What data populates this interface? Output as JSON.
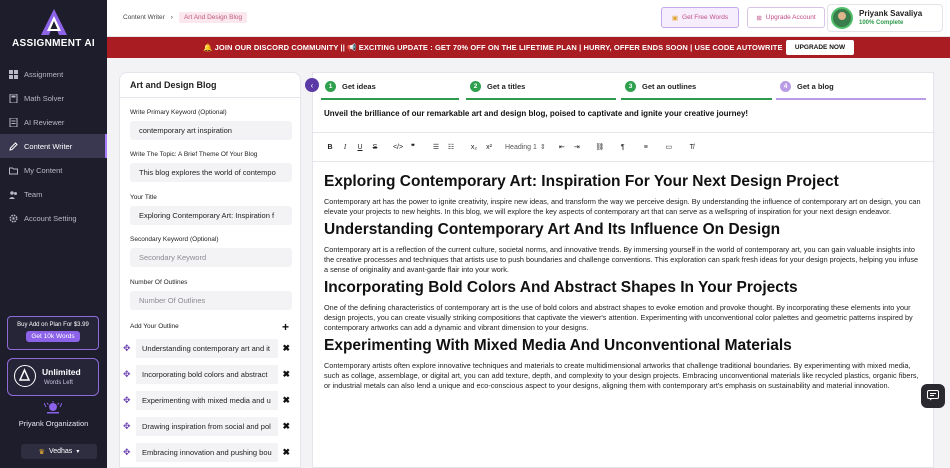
{
  "sidebar": {
    "logo_text": "ASSIGNMENT AI",
    "items": [
      {
        "label": "Assignment",
        "icon": "grid-icon"
      },
      {
        "label": "Math Solver",
        "icon": "calculator-icon"
      },
      {
        "label": "AI Reviewer",
        "icon": "document-icon"
      },
      {
        "label": "Content Writer",
        "icon": "pencil-icon",
        "active": true
      },
      {
        "label": "My Content",
        "icon": "folder-icon"
      },
      {
        "label": "Team",
        "icon": "people-icon"
      },
      {
        "label": "Account Setting",
        "icon": "gear-icon"
      }
    ],
    "addon_title": "Buy Add on Plan For $3.99",
    "addon_button": "Get 10k Words",
    "plan_title": "Unlimited",
    "plan_sub": "Words Left",
    "org_name": "Priyank Organization",
    "workspace": "Vedhas"
  },
  "topbar": {
    "breadcrumb_root": "Content Writer",
    "breadcrumb_current": "Art And Design Blog",
    "free_words": "Get Free Words",
    "upgrade": "Upgrade Account",
    "user_name": "Priyank Savaliya",
    "user_status": "100% Complete"
  },
  "banner": {
    "text": "🔔 JOIN OUR DISCORD COMMUNITY || 📢 EXCITING UPDATE : GET 70% OFF ON THE LIFETIME PLAN | HURRY, OFFER ENDS SOON | USE CODE AUTOWRITE",
    "button": "UPGRADE NOW"
  },
  "form": {
    "title": "Art and Design Blog",
    "primary_keyword_label": "Write Primary Keyword (Optional)",
    "primary_keyword_value": "contemporary art inspiration",
    "topic_label": "Write The Topic: A Brief Theme Of Your Blog",
    "topic_value": "This blog explores the world of contempo",
    "title_label": "Your Title",
    "title_value": "Exploring Contemporary Art: Inspiration f",
    "secondary_label": "Secondary Keyword (Optional)",
    "secondary_placeholder": "Secondary Keyword",
    "outlines_label": "Number Of Outlines",
    "outlines_placeholder": "Number Of Outlines",
    "add_outline_label": "Add Your Outline",
    "outline_items": [
      "Understanding contemporary art and it",
      "Incorporating bold colors and abstract",
      "Experimenting with mixed media and u",
      "Drawing inspiration from social and pol",
      "Embracing innovation and pushing bou"
    ]
  },
  "steps": [
    {
      "num": "1",
      "label": "Get ideas"
    },
    {
      "num": "2",
      "label": "Get a titles"
    },
    {
      "num": "3",
      "label": "Get an outlines"
    },
    {
      "num": "4",
      "label": "Get a blog"
    }
  ],
  "editor": {
    "intro": "Unveil the brilliance of our remarkable art and design blog, poised to captivate and ignite your creative journey!",
    "heading_select": "Heading 1",
    "h1": "Exploring Contemporary Art: Inspiration For Your Next Design Project",
    "p1": "Contemporary art has the power to ignite creativity, inspire new ideas, and transform the way we perceive design. By understanding the influence of contemporary art on design, you can elevate your projects to new heights. In this blog, we will explore the key aspects of contemporary art that can serve as a wellspring of inspiration for your next design endeavor.",
    "h2a": "Understanding Contemporary Art And Its Influence On Design",
    "p2": "Contemporary art is a reflection of the current culture, societal norms, and innovative trends. By immersing yourself in the world of contemporary art, you can gain valuable insights into the creative processes and techniques that artists use to push boundaries and challenge conventions. This exploration can spark fresh ideas for your design projects, helping you infuse a sense of originality and avant-garde flair into your work.",
    "h2b": "Incorporating Bold Colors And Abstract Shapes In Your Projects",
    "p3": "One of the defining characteristics of contemporary art is the use of bold colors and abstract shapes to evoke emotion and provoke thought. By incorporating these elements into your design projects, you can create visually striking compositions that captivate the viewer's attention. Experimenting with unconventional color palettes and geometric patterns inspired by contemporary artworks can add a dynamic and vibrant dimension to your designs.",
    "h2c": "Experimenting With Mixed Media And Unconventional Materials",
    "p4": "Contemporary artists often explore innovative techniques and materials to create multidimensional artworks that challenge traditional boundaries. By experimenting with mixed media, such as collage, assemblage, or digital art, you can add texture, depth, and complexity to your design projects. Embracing unconventional materials like recycled plastics, organic fibers, or industrial metals can also lend a unique and eco-conscious aspect to your designs, aligning them with contemporary art's emphasis on sustainability and material innovation."
  },
  "colors": {
    "sidebar_bg": "#1e1d2b",
    "accent": "#8b62e8",
    "banner": "#a81c22",
    "step_done": "#2ea04e"
  }
}
